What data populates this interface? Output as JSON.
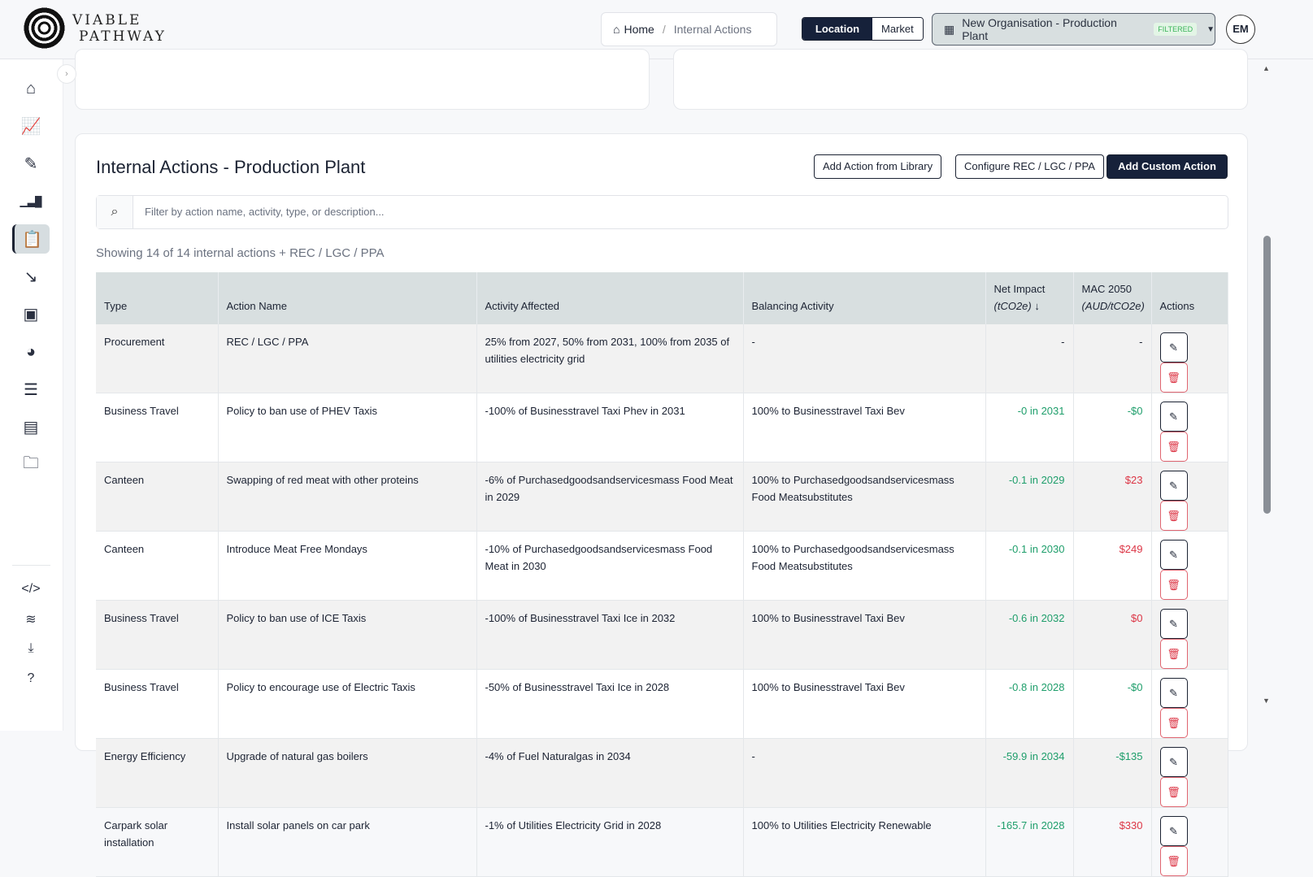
{
  "brand": {
    "line1": "VIABLE",
    "line2": "PATHWAY"
  },
  "breadcrumb": {
    "home": "Home",
    "current": "Internal Actions"
  },
  "toggle": {
    "location": "Location",
    "market": "Market"
  },
  "org": {
    "name": "New Organisation - Production Plant",
    "badge": "FILTERED"
  },
  "user": {
    "initials": "EM"
  },
  "sidebar": [
    "home-icon",
    "line-chart-icon",
    "pencil-icon",
    "bar-chart-icon",
    "clipboard-check-icon",
    "trend-down-icon",
    "image-icon",
    "globe-icon",
    "list-tree-icon",
    "document-icon",
    "folder-check-icon"
  ],
  "sidebar_bottom": [
    "code-icon",
    "database-icon",
    "file-download-icon",
    "help-icon"
  ],
  "page": {
    "title": "Internal Actions - Production Plant",
    "btn_library": "Add Action from Library",
    "btn_configure": "Configure REC / LGC / PPA",
    "btn_custom": "Add Custom Action",
    "search_placeholder": "Filter by action name, activity, type, or description...",
    "count": "Showing 14 of 14 internal actions + REC / LGC / PPA"
  },
  "table": {
    "headers": {
      "type": "Type",
      "name": "Action Name",
      "activity": "Activity Affected",
      "balancing": "Balancing Activity",
      "net1": "Net Impact",
      "net2": "(tCO2e)",
      "mac1": "MAC 2050",
      "mac2": "(AUD/tCO2e)",
      "actions": "Actions"
    },
    "rows": [
      {
        "type": "Procurement",
        "name": "REC / LGC / PPA",
        "activity": "25% from 2027, 50% from 2031, 100% from 2035 of utilities electricity grid",
        "balancing": "-",
        "net": "-",
        "mac": "-",
        "net_color": "",
        "mac_color": ""
      },
      {
        "type": "Business Travel",
        "name": "Policy to ban use of PHEV Taxis",
        "activity": "-100% of Businesstravel Taxi Phev in 2031",
        "balancing": "100% to Businesstravel Taxi Bev",
        "net": "-0 in 2031",
        "mac": "-$0",
        "net_color": "g",
        "mac_color": "g"
      },
      {
        "type": "Canteen",
        "name": "Swapping of red meat with other proteins",
        "activity": "-6% of Purchasedgoodsandservicesmass Food Meat in 2029",
        "balancing": "100% to Purchasedgoodsandservicesmass Food Meatsubstitutes",
        "net": "-0.1 in 2029",
        "mac": "$23",
        "net_color": "g",
        "mac_color": "r"
      },
      {
        "type": "Canteen",
        "name": "Introduce Meat Free Mondays",
        "activity": "-10% of Purchasedgoodsandservicesmass Food Meat in 2030",
        "balancing": "100% to Purchasedgoodsandservicesmass Food Meatsubstitutes",
        "net": "-0.1 in 2030",
        "mac": "$249",
        "net_color": "g",
        "mac_color": "r"
      },
      {
        "type": "Business Travel",
        "name": "Policy to ban use of ICE Taxis",
        "activity": "-100% of Businesstravel Taxi Ice in 2032",
        "balancing": "100% to Businesstravel Taxi Bev",
        "net": "-0.6 in 2032",
        "mac": "$0",
        "net_color": "g",
        "mac_color": "r"
      },
      {
        "type": "Business Travel",
        "name": "Policy to encourage use of Electric Taxis",
        "activity": "-50% of Businesstravel Taxi Ice in 2028",
        "balancing": "100% to Businesstravel Taxi Bev",
        "net": "-0.8 in 2028",
        "mac": "-$0",
        "net_color": "g",
        "mac_color": "g"
      },
      {
        "type": "Energy Efficiency",
        "name": "Upgrade of natural gas boilers",
        "activity": "-4% of Fuel Naturalgas in 2034",
        "balancing": "-",
        "net": "-59.9 in 2034",
        "mac": "-$135",
        "net_color": "g",
        "mac_color": "g"
      },
      {
        "type": "Carpark solar installation",
        "name": "Install solar panels on car park",
        "activity": "-1% of Utilities Electricity Grid in 2028",
        "balancing": "100% to Utilities Electricity Renewable",
        "net": "-165.7 in 2028",
        "mac": "$330",
        "net_color": "g",
        "mac_color": "r"
      }
    ]
  },
  "colors": {
    "accent": "#16213a",
    "green": "#1e9e6b",
    "red": "#dc3545"
  }
}
